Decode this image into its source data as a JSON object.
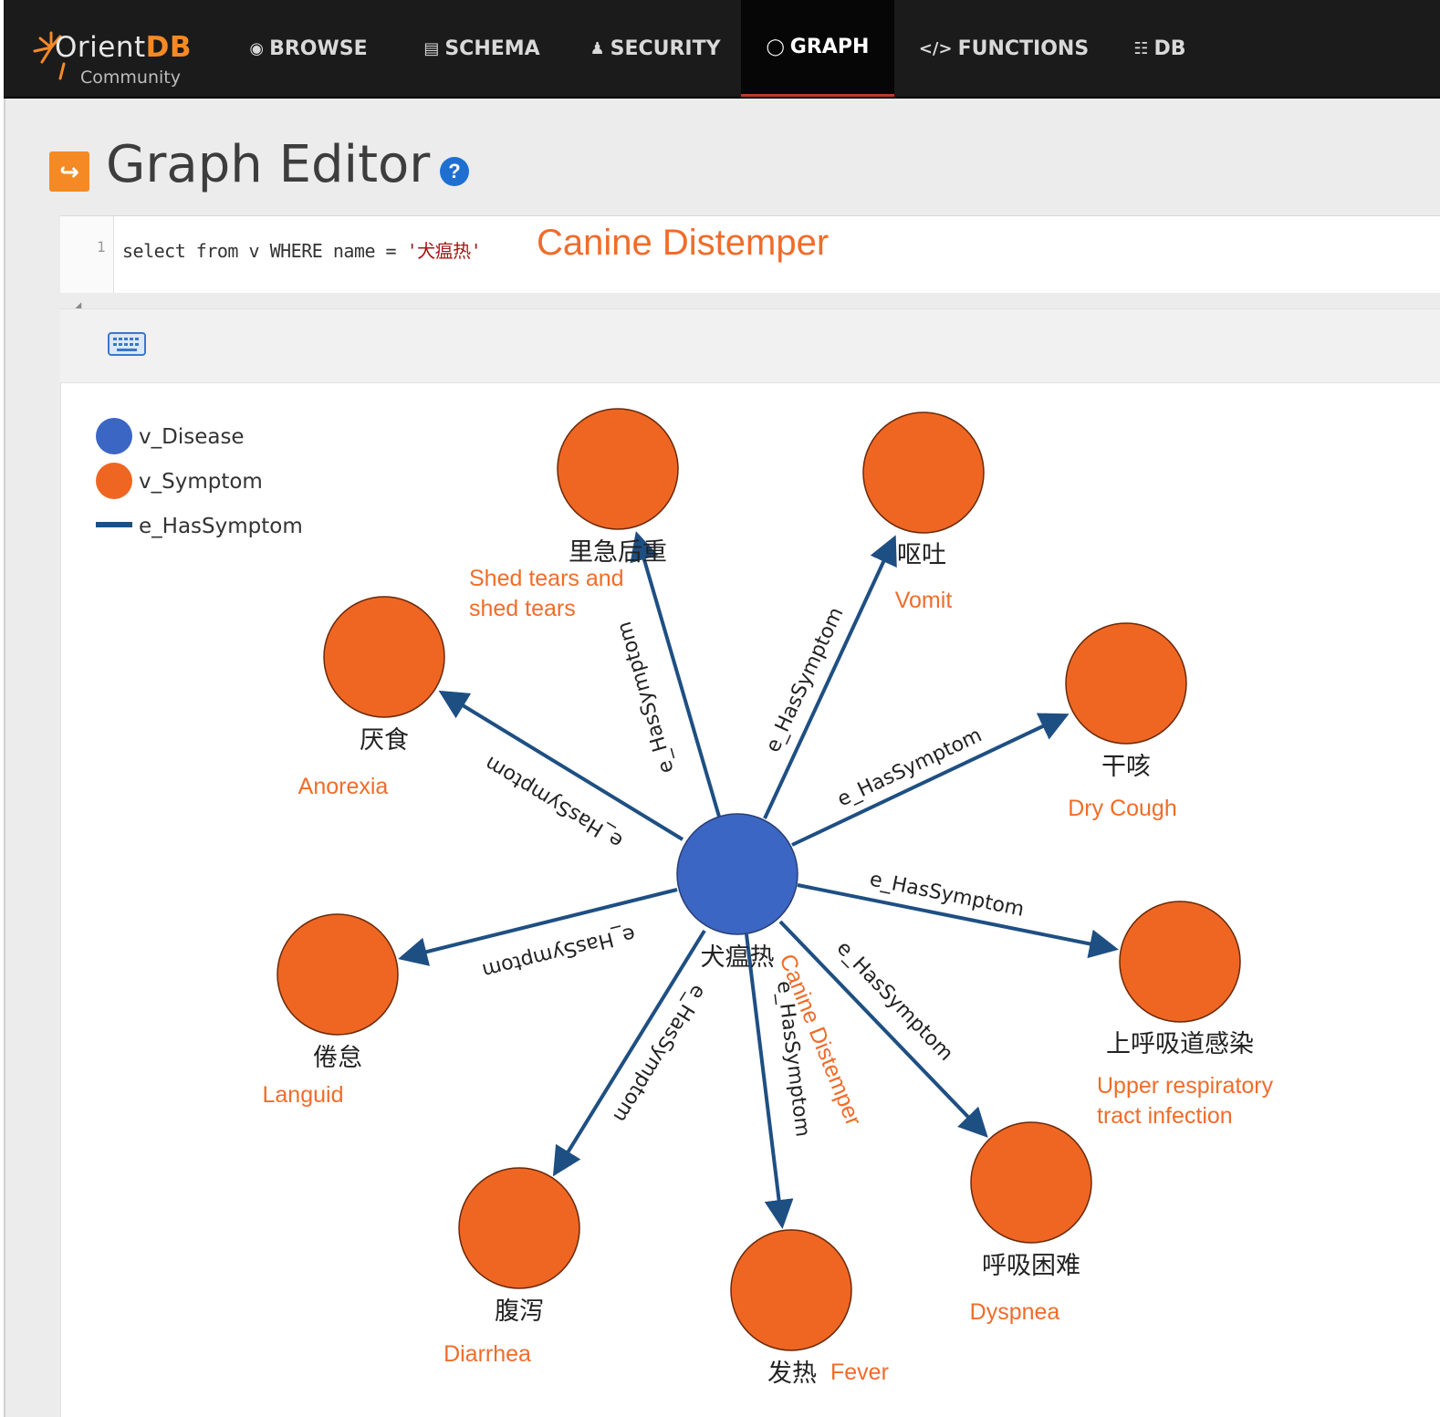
{
  "app": {
    "logo_name_prefix": "Orient",
    "logo_name_suffix": "DB",
    "logo_subtitle": "Community"
  },
  "nav": {
    "items": [
      {
        "label": "BROWSE",
        "icon": "eye-icon"
      },
      {
        "label": "SCHEMA",
        "icon": "table-icon"
      },
      {
        "label": "SECURITY",
        "icon": "user-icon"
      },
      {
        "label": "GRAPH",
        "icon": "circle-icon",
        "active": true
      },
      {
        "label": "FUNCTIONS",
        "icon": "code-icon"
      },
      {
        "label": "DB",
        "icon": "database-icon"
      }
    ]
  },
  "page": {
    "title": "Graph Editor"
  },
  "editor": {
    "line_number": "1",
    "query_prefix": "select from v WHERE name = ",
    "query_string": "'犬瘟热'",
    "annotation": "Canine Distemper"
  },
  "legend": [
    {
      "label": "v_Disease",
      "kind": "vertex",
      "color": "#3c66c4"
    },
    {
      "label": "v_Symptom",
      "kind": "vertex",
      "color": "#ef6623"
    },
    {
      "label": "e_HasSymptom",
      "kind": "edge",
      "color": "#1e4f83"
    }
  ],
  "graph": {
    "center": {
      "name": "犬瘟热",
      "translation": "Canine Distemper",
      "class": "v_Disease"
    },
    "edge_label": "e_HasSymptom",
    "symptoms": [
      {
        "name": "里急后重",
        "translation": [
          "Shed tears and",
          "shed tears"
        ]
      },
      {
        "name": "呕吐",
        "translation": [
          "Vomit"
        ]
      },
      {
        "name": "干咳",
        "translation": [
          "Dry Cough"
        ]
      },
      {
        "name": "上呼吸道感染",
        "translation": [
          "Upper respiratory",
          "tract infection"
        ]
      },
      {
        "name": "呼吸困难",
        "translation": [
          "Dyspnea"
        ]
      },
      {
        "name": "发热",
        "translation": [
          "Fever"
        ]
      },
      {
        "name": "腹泻",
        "translation": [
          "Diarrhea"
        ]
      },
      {
        "name": "倦怠",
        "translation": [
          "Languid"
        ]
      },
      {
        "name": "厌食",
        "translation": [
          "Anorexia"
        ]
      }
    ],
    "colors": {
      "disease": "#3c66c4",
      "symptom": "#ef6623",
      "edge": "#1e4f83"
    }
  }
}
